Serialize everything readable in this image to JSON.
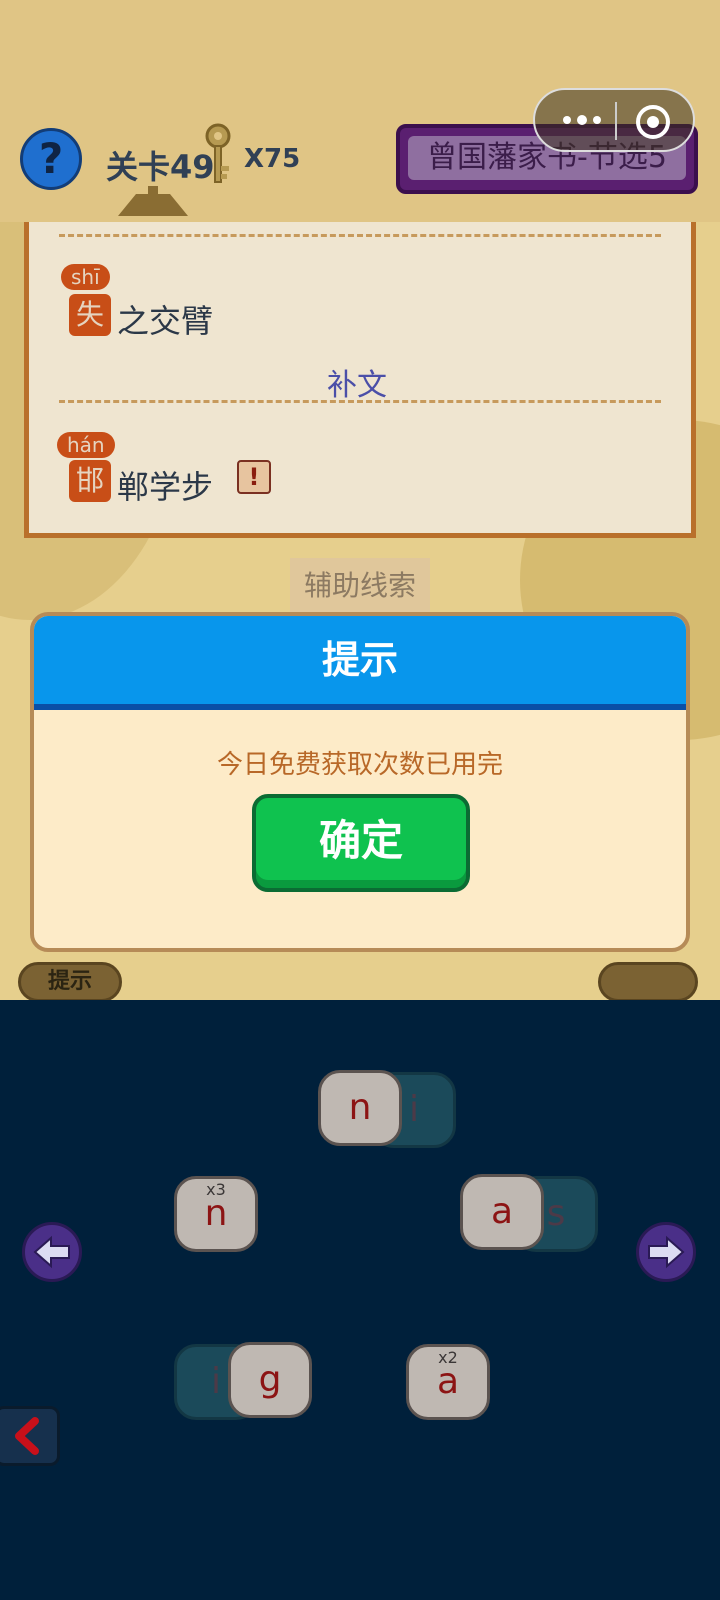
{
  "top_bar": {
    "level_label": "关卡49",
    "key_count": "X75",
    "title": "曾国藩家书-节选5",
    "help_icon_text": "?"
  },
  "panel": {
    "row1": {
      "pinyin": "shī",
      "char": "失",
      "rest": "之交臂"
    },
    "hint_text": "补文",
    "row2": {
      "pinyin": "hán",
      "char": "邯",
      "rest": "郸学步"
    },
    "warning_icon_text": "!"
  },
  "clue_label": "辅助线索",
  "hint_tool_label": "提示",
  "keyboard": {
    "tiles": [
      {
        "letter": "n",
        "badge": ""
      },
      {
        "letter": "i",
        "badge": ""
      },
      {
        "letter": "n",
        "badge": "x3"
      },
      {
        "letter": "a",
        "badge": ""
      },
      {
        "letter": "s",
        "badge": ""
      },
      {
        "letter": "i",
        "badge": ""
      },
      {
        "letter": "g",
        "badge": ""
      },
      {
        "letter": "a",
        "badge": "x2"
      }
    ]
  },
  "dialog": {
    "title": "提示",
    "message": "今日免费获取次数已用完",
    "confirm_label": "确定"
  },
  "colors": {
    "dialog_header": "#0896ec",
    "confirm_green": "#0fc24f",
    "dialog_body": "#fdebc8",
    "keyboard_bg": "#00203b"
  }
}
